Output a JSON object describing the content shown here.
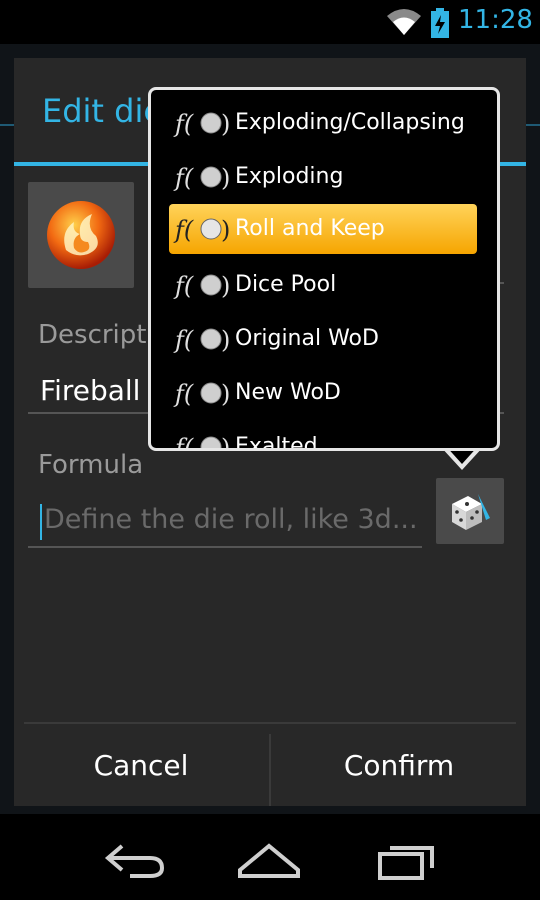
{
  "status_bar": {
    "time": "11:28",
    "icons": [
      "wifi-icon",
      "battery-charging-icon"
    ],
    "accent": "#33b5e5"
  },
  "dialog": {
    "title": "Edit die",
    "accent": "#33b5e5",
    "description": {
      "label": "Description",
      "value": "Fireball"
    },
    "formula": {
      "label": "Formula",
      "placeholder": "Define the die roll, like 3d..."
    },
    "buttons": {
      "cancel": "Cancel",
      "confirm": "Confirm"
    }
  },
  "popup_menu": {
    "items": [
      {
        "label": "Exploding/Collapsing",
        "icon": "formula-fx-icon"
      },
      {
        "label": "Exploding",
        "icon": "formula-fx-icon"
      },
      {
        "label": "Roll and Keep",
        "icon": "formula-fx-icon",
        "selected": true
      },
      {
        "label": "Dice Pool",
        "icon": "formula-fx-icon"
      },
      {
        "label": "Original WoD",
        "icon": "formula-fx-icon"
      },
      {
        "label": "New WoD",
        "icon": "formula-fx-icon"
      },
      {
        "label": "Exalted",
        "icon": "formula-fx-icon"
      }
    ],
    "selected_color": "#f6a500"
  },
  "nav_bar": {
    "icons": [
      "back-icon",
      "home-icon",
      "recent-apps-icon"
    ]
  }
}
